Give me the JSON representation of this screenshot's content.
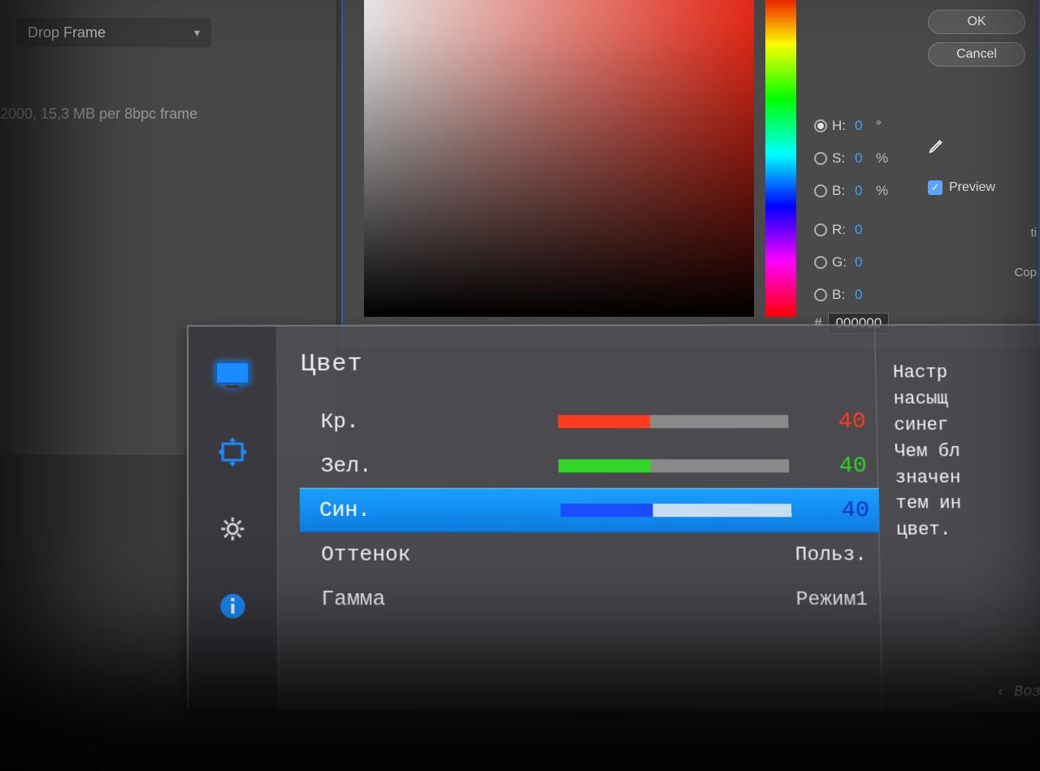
{
  "bg": {
    "drop_frame": "Drop Frame",
    "frame_info": "2000, 15,3 MB per 8bpc frame",
    "ok": "OK",
    "cancel": "Cancel",
    "preview": "Preview",
    "side_ti": "ti",
    "side_copy": "Cop",
    "hsb": {
      "h_label": "H:",
      "h_val": "0",
      "h_unit": "°",
      "s_label": "S:",
      "s_val": "0",
      "s_unit": "%",
      "b_label": "B:",
      "b_val": "0",
      "b_unit": "%"
    },
    "rgb": {
      "r_label": "R:",
      "r_val": "0",
      "g_label": "G:",
      "g_val": "0",
      "b_label": "B:",
      "b_val": "0"
    },
    "hex_hash": "#",
    "hex_val": "000000"
  },
  "osd": {
    "title": "Цвет",
    "rows": {
      "red": {
        "label": "Кр.",
        "value": "40"
      },
      "green": {
        "label": "Зел.",
        "value": "40"
      },
      "blue": {
        "label": "Син.",
        "value": "40"
      },
      "tint": {
        "label": "Оттенок",
        "value": "Польз."
      },
      "gamma": {
        "label": "Гамма",
        "value": "Режим1"
      }
    },
    "desc_lines": [
      "Настр",
      "насыщ",
      "синег",
      "Чем бл",
      "значен",
      "тем ин",
      "цвет."
    ],
    "footer": "‹   Воз"
  }
}
